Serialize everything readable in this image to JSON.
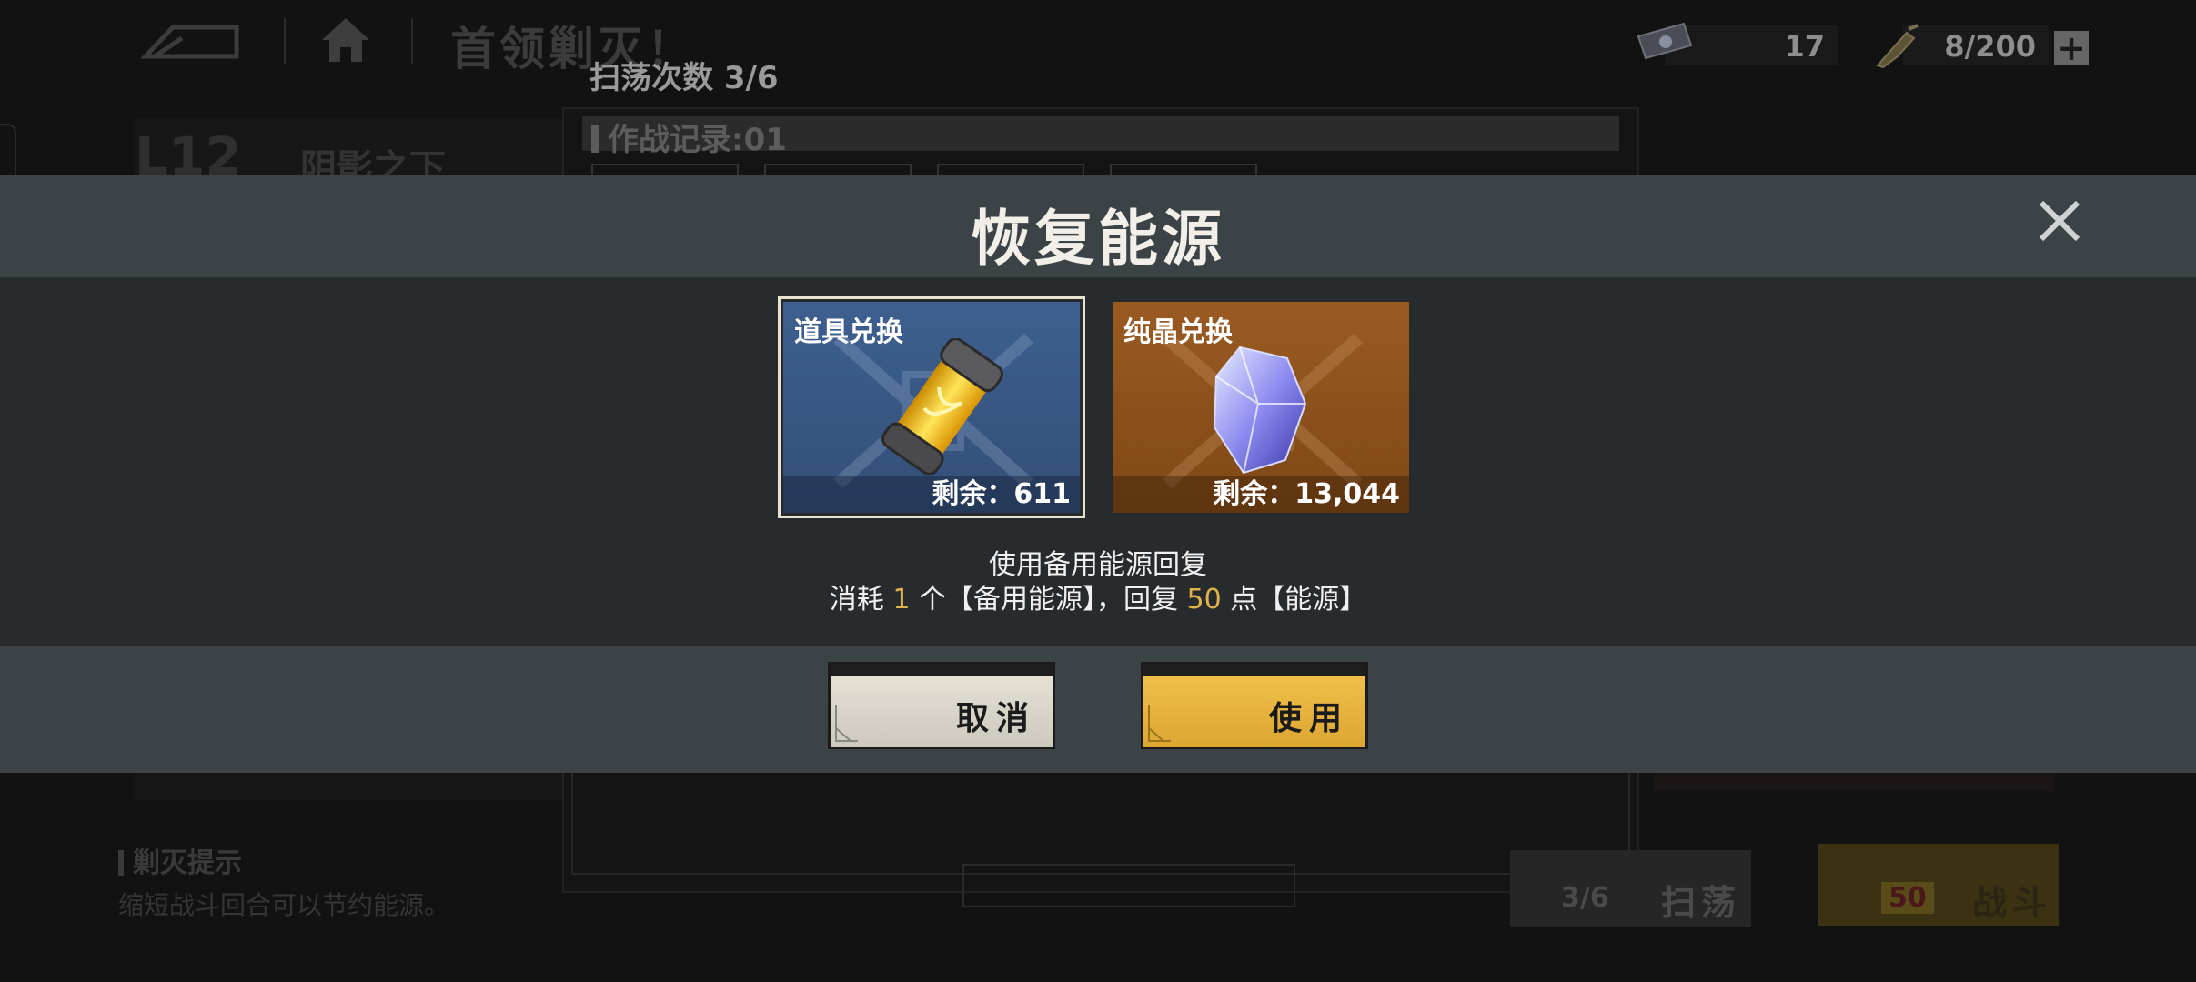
{
  "background": {
    "title": "首领剿灭！",
    "sweep_count": "扫荡次数 3/6",
    "resources": [
      {
        "icon": "ticket-icon",
        "value": "17"
      },
      {
        "icon": "energy-syringe-icon",
        "value": "8/200"
      }
    ],
    "plus_label": "+",
    "stage": {
      "number": "L12",
      "name": "阴影之下"
    },
    "record_label": "作战记录:01",
    "tip": {
      "title": "剿灭提示",
      "text": "缩短战斗回合可以节约能源。"
    },
    "sweep_button": {
      "count": "3/6",
      "label": "扫荡"
    },
    "fight_button": {
      "cost": "50",
      "label": "战斗"
    }
  },
  "dialog": {
    "title": "恢复能源",
    "options": [
      {
        "label": "道具兑换",
        "remaining": "剩余：611",
        "icon": "energy-capsule-icon",
        "selected": true
      },
      {
        "label": "纯晶兑换",
        "remaining": "剩余：13,044",
        "icon": "crystal-icon",
        "selected": false
      }
    ],
    "description": {
      "line1": "使用备用能源回复",
      "line2_prefix": "消耗 ",
      "cost": "1",
      "line2_middle": " 个【备用能源】，回复 ",
      "amount": "50",
      "line2_suffix": " 点【能源】"
    },
    "cancel_label": "取消",
    "use_label": "使用"
  },
  "colors": {
    "accent_gold": "#e0b24a",
    "use_button": "#e8b63c",
    "item_card": "#3a5a89",
    "crystal_card": "#8d521c"
  }
}
